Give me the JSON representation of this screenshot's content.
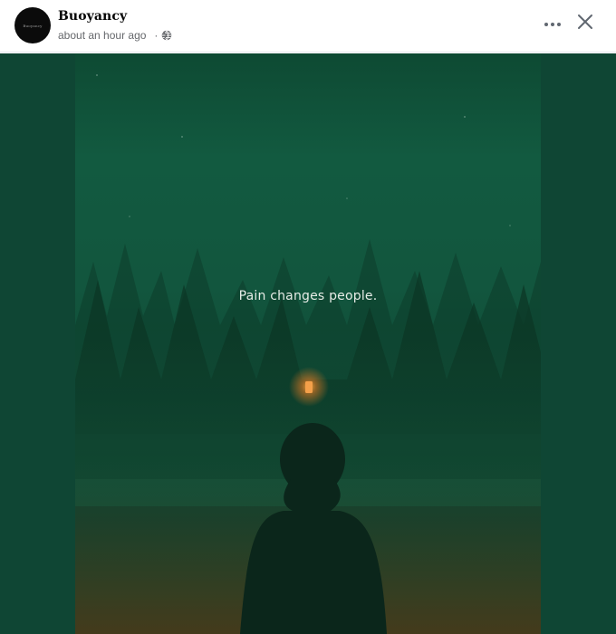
{
  "post": {
    "author": {
      "name": "Buoyancy",
      "avatar_text": "Buoyancy"
    },
    "timestamp": "about an hour ago",
    "separator": "·",
    "privacy_icon": "globe-icon",
    "actions": {
      "more_icon": "more-horizontal-icon",
      "close_icon": "close-icon"
    },
    "image": {
      "caption_text": "Pain changes people."
    }
  },
  "colors": {
    "header_bg": "#ffffff",
    "media_bg": "#0f4634",
    "name_color": "#050505",
    "meta_color": "#65676b",
    "lantern": "#f08a2a"
  }
}
